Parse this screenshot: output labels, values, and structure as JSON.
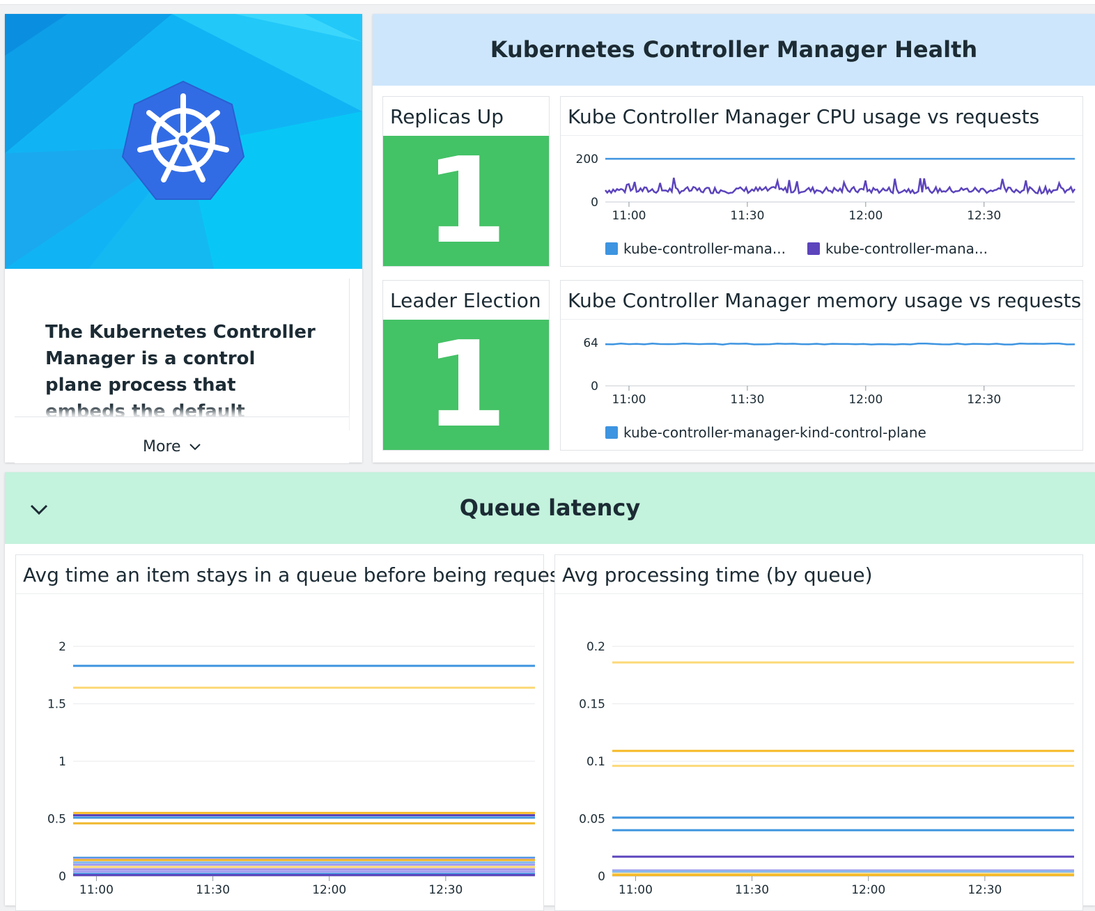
{
  "intro": {
    "text": "The Kubernetes Controller Manager is a control plane process that embeds the default control loops in",
    "more_label": "More"
  },
  "health": {
    "title": "Kubernetes Controller Manager Health",
    "replicas": {
      "title": "Replicas Up",
      "value": "1",
      "color": "#44c266"
    },
    "leader": {
      "title": "Leader Election",
      "value": "1",
      "color": "#44c266"
    },
    "cpu": {
      "title": "Kube Controller Manager CPU usage vs requests",
      "legend": [
        "kube-controller-mana...",
        "kube-controller-mana..."
      ]
    },
    "memory": {
      "title": "Kube Controller Manager memory usage vs requests",
      "legend": [
        "kube-controller-manager-kind-control-plane"
      ]
    }
  },
  "queue": {
    "title": "Queue latency",
    "wait_title": "Avg time an item stays in a queue before being request...",
    "proc_title": "Avg processing time (by queue)"
  },
  "chart_data": [
    {
      "id": "cpu",
      "type": "line",
      "title": "Kube Controller Manager CPU usage vs requests",
      "x": [
        "11:00",
        "11:30",
        "12:00",
        "12:30"
      ],
      "ylim": [
        0,
        200
      ],
      "yticks": [
        0,
        200
      ],
      "series": [
        {
          "name": "kube-controller-mana...",
          "color": "#3d94e0",
          "constant": 200
        },
        {
          "name": "kube-controller-mana...",
          "color": "#5c44bc",
          "approx_mean": 55,
          "approx_range": [
            35,
            115
          ]
        }
      ]
    },
    {
      "id": "memory",
      "type": "line",
      "title": "Kube Controller Manager memory usage vs requests",
      "x": [
        "11:00",
        "11:30",
        "12:00",
        "12:30"
      ],
      "ylim": [
        0,
        64
      ],
      "yticks": [
        0,
        64
      ],
      "series": [
        {
          "name": "kube-controller-manager-kind-control-plane",
          "color": "#3d94e0",
          "approx_value": 62
        }
      ]
    },
    {
      "id": "wait",
      "type": "line",
      "title": "Avg time an item stays in a queue before being request...",
      "x": [
        "11:00",
        "11:30",
        "12:00",
        "12:30"
      ],
      "ylim": [
        0,
        2
      ],
      "yticks": [
        0,
        0.5,
        1,
        1.5,
        2
      ],
      "ytick_labels": [
        "0",
        "0.5",
        "1",
        "1.5",
        "2"
      ],
      "series": [
        {
          "color": "#3d94e0",
          "value": 1.83
        },
        {
          "color": "#fcd978",
          "value": 1.64
        },
        {
          "color": "#f7b924",
          "value": 0.55
        },
        {
          "color": "#5c44bc",
          "value": 0.53
        },
        {
          "color": "#3d94e0",
          "value": 0.51
        },
        {
          "color": "#f0b72c",
          "value": 0.46
        },
        {
          "color": "#3d94e0",
          "value": 0.16
        },
        {
          "color": "#a39ff0",
          "value": 0.15
        },
        {
          "color": "#f7b924",
          "value": 0.14
        },
        {
          "color": "#84b8ec",
          "value": 0.12
        },
        {
          "color": "#a39ff0",
          "value": 0.1
        },
        {
          "color": "#fcd978",
          "value": 0.08
        },
        {
          "color": "#9f90e8",
          "value": 0.06
        },
        {
          "color": "#a39ff0",
          "value": 0.04
        },
        {
          "color": "#3d94e0",
          "value": 0.02
        },
        {
          "color": "#5c44bc",
          "value": 0.01
        }
      ]
    },
    {
      "id": "proc",
      "type": "line",
      "title": "Avg processing time (by queue)",
      "x": [
        "11:00",
        "11:30",
        "12:00",
        "12:30"
      ],
      "ylim": [
        0,
        0.2
      ],
      "yticks": [
        0,
        0.05,
        0.1,
        0.15,
        0.2
      ],
      "ytick_labels": [
        "0",
        "0.05",
        "0.1",
        "0.15",
        "0.2"
      ],
      "series": [
        {
          "color": "#fcd978",
          "value": 0.186
        },
        {
          "color": "#f7b924",
          "value": 0.109
        },
        {
          "color": "#fcd978",
          "value": 0.096
        },
        {
          "color": "#3d94e0",
          "value": 0.051
        },
        {
          "color": "#3d94e0",
          "value": 0.04
        },
        {
          "color": "#5c44bc",
          "value": 0.017
        },
        {
          "color": "#a39ff0",
          "value": 0.005
        },
        {
          "color": "#84b8ec",
          "value": 0.004
        },
        {
          "color": "#fcd978",
          "value": 0.002
        },
        {
          "color": "#f7b924",
          "value": 0.001
        }
      ]
    }
  ]
}
